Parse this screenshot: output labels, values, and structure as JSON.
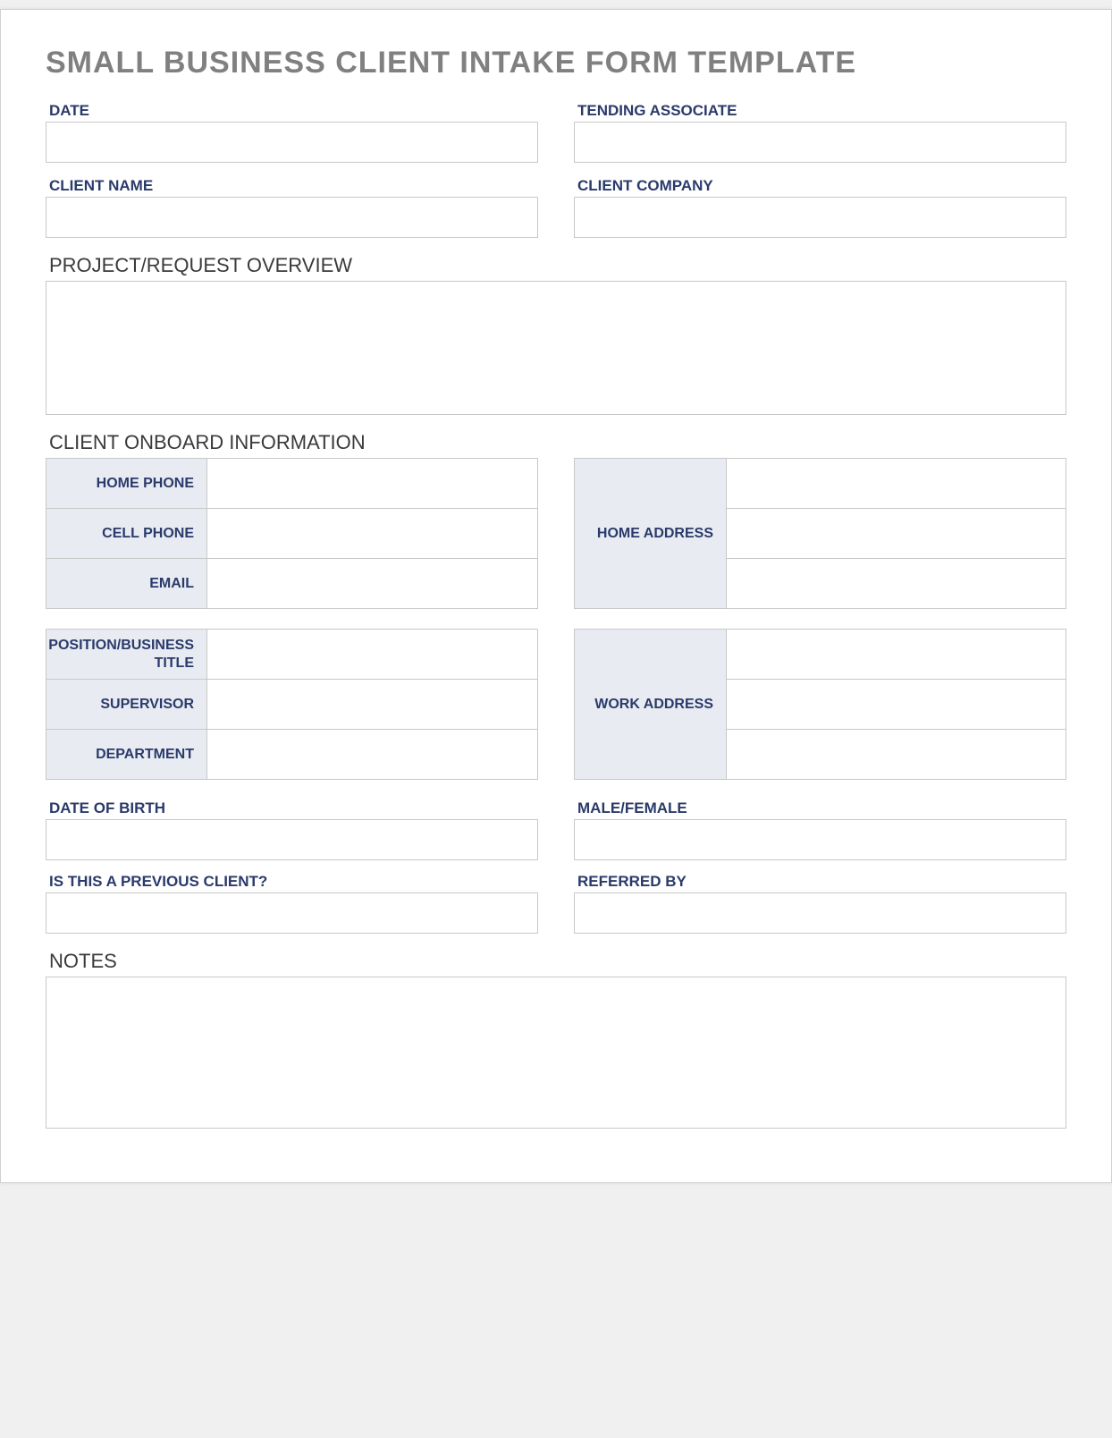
{
  "title": "SMALL BUSINESS CLIENT INTAKE FORM TEMPLATE",
  "fields": {
    "date": "DATE",
    "tending_associate": "TENDING ASSOCIATE",
    "client_name": "CLIENT NAME",
    "client_company": "CLIENT COMPANY",
    "project_overview": "PROJECT/REQUEST OVERVIEW",
    "client_onboard": "CLIENT ONBOARD INFORMATION",
    "home_phone": "HOME PHONE",
    "cell_phone": "CELL PHONE",
    "email": "EMAIL",
    "home_address": "HOME ADDRESS",
    "position_title": "POSITION/BUSINESS TITLE",
    "supervisor": "SUPERVISOR",
    "department": "DEPARTMENT",
    "work_address": "WORK ADDRESS",
    "dob": "DATE OF BIRTH",
    "male_female": "MALE/FEMALE",
    "previous_client": "IS THIS A PREVIOUS CLIENT?",
    "referred_by": "REFERRED BY",
    "notes": "NOTES"
  }
}
